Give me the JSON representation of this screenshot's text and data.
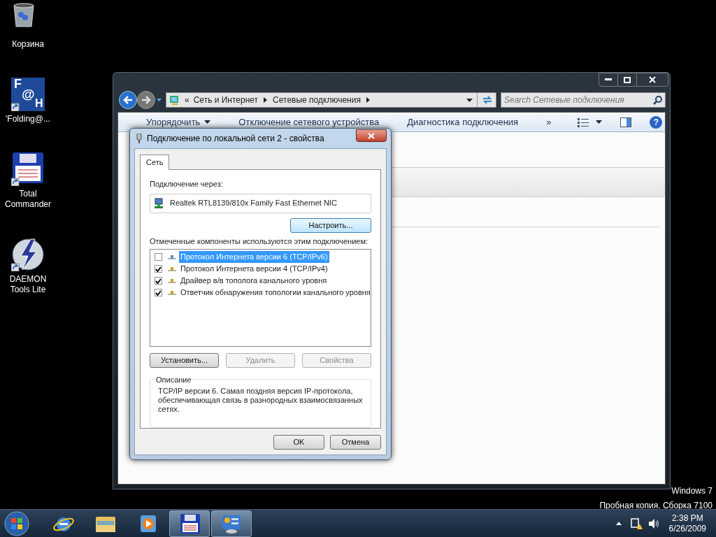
{
  "desktop_icons": [
    {
      "kind": "recycle",
      "label": "Корзина"
    },
    {
      "kind": "fah",
      "label": "'Folding@...",
      "glyphs": [
        "F",
        "@",
        "H"
      ]
    },
    {
      "kind": "floppy",
      "label": "Total Commander"
    },
    {
      "kind": "daemon",
      "label": "DAEMON Tools Lite"
    }
  ],
  "explorer": {
    "breadcrumb_prefix": "«",
    "breadcrumb": [
      "Сеть и Интернет",
      "Сетевые подключения"
    ],
    "search": {
      "placeholder": "Search Сетевые подключения"
    },
    "toolbar": [
      "Упорядочить",
      "Отключение сетевого устройства",
      "Диагностика подключения",
      "»"
    ],
    "help": "?"
  },
  "dialog": {
    "title": "Подключение по локальной сети 2 - свойства",
    "tabs": [
      {
        "label": "Сеть",
        "selected": true
      }
    ],
    "connect_label": "Подключение через:",
    "adapter": "Realtek RTL8139/810x Family Fast Ethernet NIC",
    "configure": "Настроить...",
    "components_label": "Отмеченные компоненты используются этим подключением:",
    "components": [
      {
        "label": "Протокол Интернета версии 6 (TCP/IPv6)",
        "checked": false,
        "selected": true
      },
      {
        "label": "Протокол Интернета версии 4 (TCP/IPv4)",
        "checked": true,
        "selected": false
      },
      {
        "label": "Драйвер в/в тополога канального уровня",
        "checked": true,
        "selected": false
      },
      {
        "label": "Ответчик обнаружения топологии канального уровня",
        "checked": true,
        "selected": false
      }
    ],
    "actions": [
      {
        "label": "Установить...",
        "disabled": false
      },
      {
        "label": "Удалить",
        "disabled": true
      },
      {
        "label": "Свойства",
        "disabled": true
      }
    ],
    "description_title": "Описание",
    "description": "TCP/IP версии 6. Самая поздняя версия IP-протокола, обеспечивающая связь в разнородных взаимосвязанных сетях.",
    "footer": [
      "OK",
      "Отмена"
    ]
  },
  "watermark": [
    "Windows 7",
    "Пробная копия. Сборка 7100"
  ],
  "taskbar": {
    "apps": [
      {
        "kind": "ie",
        "active": false
      },
      {
        "kind": "folder",
        "active": false
      },
      {
        "kind": "media",
        "active": false
      },
      {
        "kind": "floppy",
        "active": true
      },
      {
        "kind": "network",
        "active": true
      }
    ],
    "time": "2:38 PM",
    "date": "6/26/2009"
  }
}
